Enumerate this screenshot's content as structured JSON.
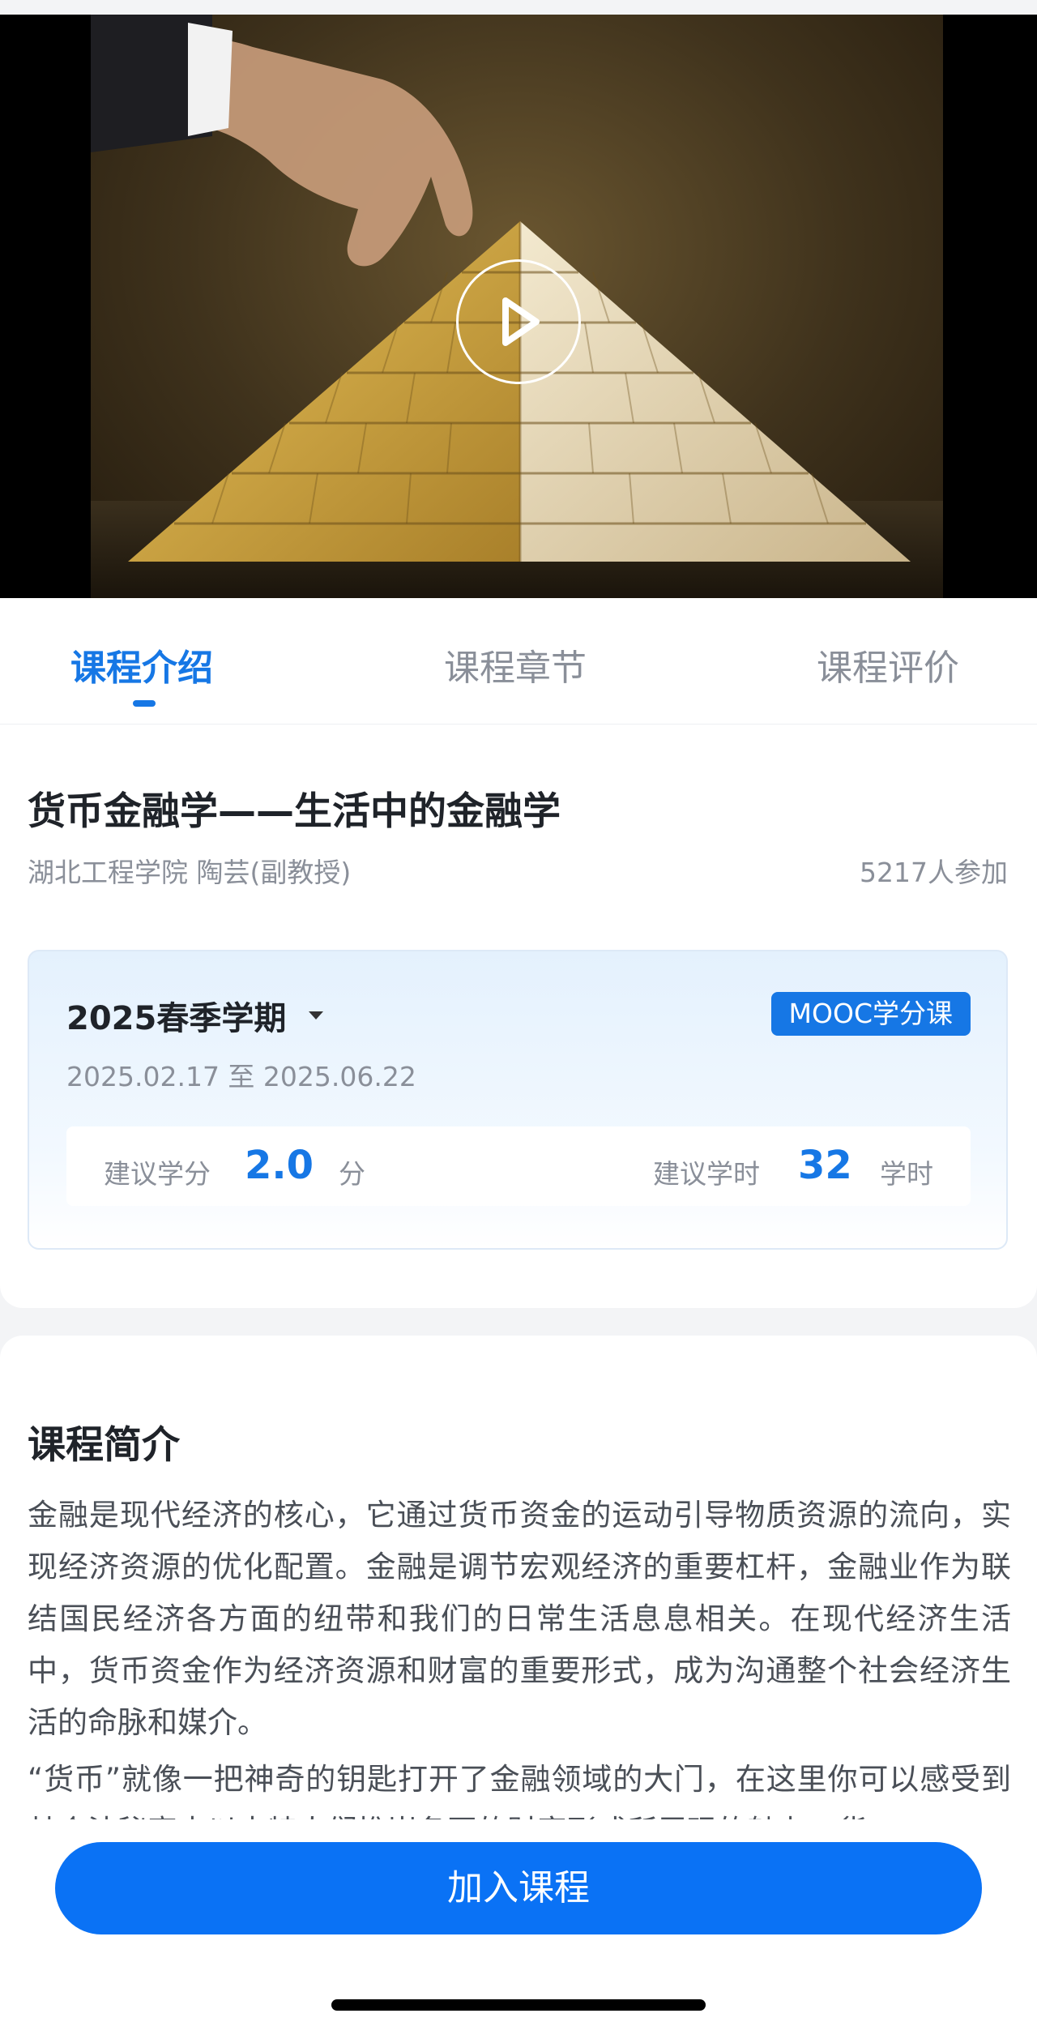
{
  "video": {
    "play_icon": "play-circle-icon"
  },
  "tabs": [
    {
      "label": "课程介绍",
      "active": true
    },
    {
      "label": "课程章节",
      "active": false
    },
    {
      "label": "课程评价",
      "active": false
    }
  ],
  "course": {
    "title": "货币金融学——生活中的金融学",
    "teacher": "湖北工程学院 陶芸(副教授)",
    "participants": "5217人参加"
  },
  "term": {
    "name": "2025春季学期",
    "badge": "MOOC学分课",
    "dates": "2025.02.17 至 2025.06.22",
    "credit_label": "建议学分",
    "credit_value": "2.0",
    "credit_unit": "分",
    "hours_label": "建议学时",
    "hours_value": "32",
    "hours_unit": "学时"
  },
  "intro": {
    "heading": "课程简介",
    "paragraphs": [
      "金融是现代经济的核心，它通过货币资金的运动引导物质资源的流向，实现经济资源的优化配置。金融是调节宏观经济的重要杠杆，金融业作为联结国民经济各方面的纽带和我们的日常生活息息相关。在现代经济生活中，货币资金作为经济资源和财富的重要形式，成为沟通整个社会经济生活的命脉和媒介。",
      "“货币”就像一把神奇的钥匙打开了金融领域的大门，在这里你可以感受到其合法秘密中以丰特人们推崇备至的财富形式所展现的魅力，货"
    ]
  },
  "actions": {
    "join_label": "加入课程"
  },
  "colors": {
    "accent": "#1677e5",
    "button": "#0a72f5"
  }
}
